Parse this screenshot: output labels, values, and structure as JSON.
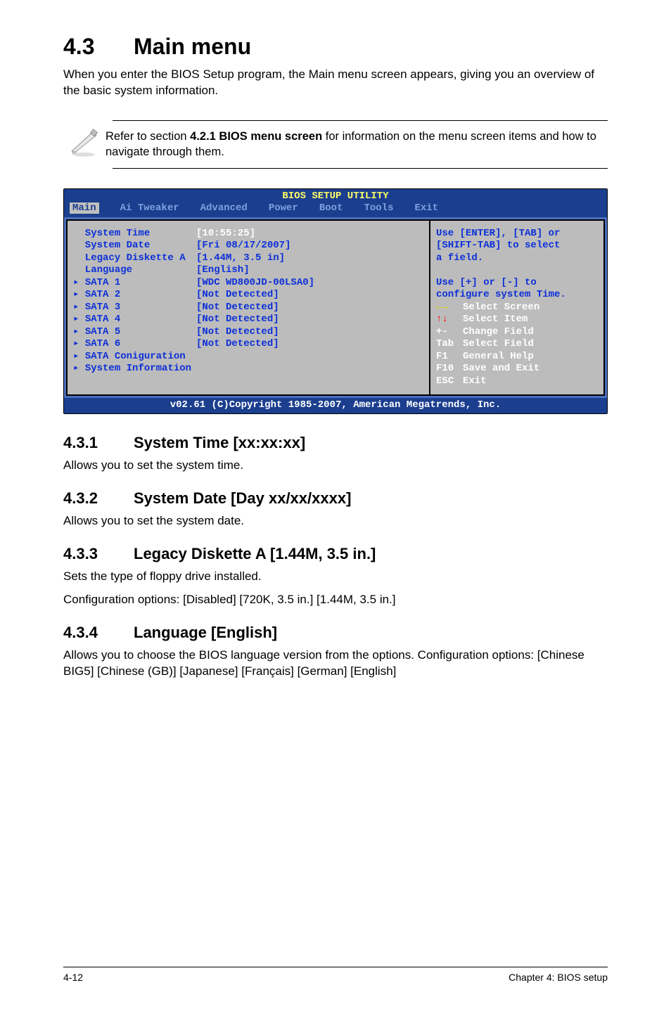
{
  "heading": {
    "number": "4.3",
    "title": "Main menu"
  },
  "intro": "When you enter the BIOS Setup program, the Main menu screen appears, giving you an overview of the basic system information.",
  "note": {
    "pre": "Refer to section ",
    "bold": "4.2.1  BIOS menu screen",
    "post": " for information on the menu screen items and how to navigate through them."
  },
  "bios": {
    "title": "BIOS SETUP UTILITY",
    "menus": [
      "Main",
      "Ai Tweaker",
      "Advanced",
      "Power",
      "Boot",
      "Tools",
      "Exit"
    ],
    "active_menu": "Main",
    "left": [
      {
        "label": "System Time",
        "value": "[10:55:25]",
        "highlight": true
      },
      {
        "label": "System Date",
        "value": "[Fri 08/17/2007]"
      },
      {
        "label": "Legacy Diskette A",
        "value": "[1.44M, 3.5 in]"
      },
      {
        "label": "Language",
        "value": "[English]"
      },
      {
        "label": "",
        "value": ""
      },
      {
        "label": "SATA 1",
        "tri": true,
        "value": "[WDC WD800JD-00LSA0]"
      },
      {
        "label": "SATA 2",
        "tri": true,
        "value": "[Not Detected]"
      },
      {
        "label": "SATA 3",
        "tri": true,
        "value": "[Not Detected]"
      },
      {
        "label": "SATA 4",
        "tri": true,
        "value": "[Not Detected]"
      },
      {
        "label": "SATA 5",
        "tri": true,
        "value": "[Not Detected]"
      },
      {
        "label": "SATA 6",
        "tri": true,
        "value": "[Not Detected]"
      },
      {
        "label": "",
        "value": ""
      },
      {
        "label": "SATA Coniguration",
        "tri": true,
        "value": ""
      },
      {
        "label": "System Information",
        "tri": true,
        "value": ""
      }
    ],
    "help_text_lines": [
      "Use [ENTER], [TAB] or",
      "[SHIFT-TAB] to select",
      "a field.",
      "",
      "Use [+] or [-] to",
      "configure system Time."
    ],
    "help_keys": [
      {
        "key": "←→",
        "desc": "Select Screen",
        "cls": "sel"
      },
      {
        "key": "↑↓",
        "desc": "Select Item",
        "cls": "cursor"
      },
      {
        "key": "+-",
        "desc": "Change Field"
      },
      {
        "key": "Tab",
        "desc": "Select Field"
      },
      {
        "key": "F1",
        "desc": "General Help"
      },
      {
        "key": "F10",
        "desc": "Save and Exit"
      },
      {
        "key": "ESC",
        "desc": "Exit"
      }
    ],
    "footer": "v02.61 (C)Copyright 1985-2007, American Megatrends, Inc."
  },
  "subsections": [
    {
      "num": "4.3.1",
      "title": "System Time [xx:xx:xx]",
      "lines": [
        "Allows you to set the system time."
      ]
    },
    {
      "num": "4.3.2",
      "title": "System Date [Day xx/xx/xxxx]",
      "lines": [
        "Allows you to set the system date."
      ]
    },
    {
      "num": "4.3.3",
      "title": "Legacy Diskette A [1.44M, 3.5 in.]",
      "lines": [
        "Sets the type of floppy drive installed.",
        "Configuration options: [Disabled] [720K, 3.5 in.] [1.44M, 3.5 in.]"
      ]
    },
    {
      "num": "4.3.4",
      "title": "Language [English]",
      "lines": [
        "Allows you to choose the BIOS language version from the options. Configuration options: [Chinese BIG5] [Chinese (GB)] [Japanese] [Français] [German] [English]"
      ]
    }
  ],
  "footer": {
    "left": "4-12",
    "right": "Chapter 4: BIOS setup"
  }
}
